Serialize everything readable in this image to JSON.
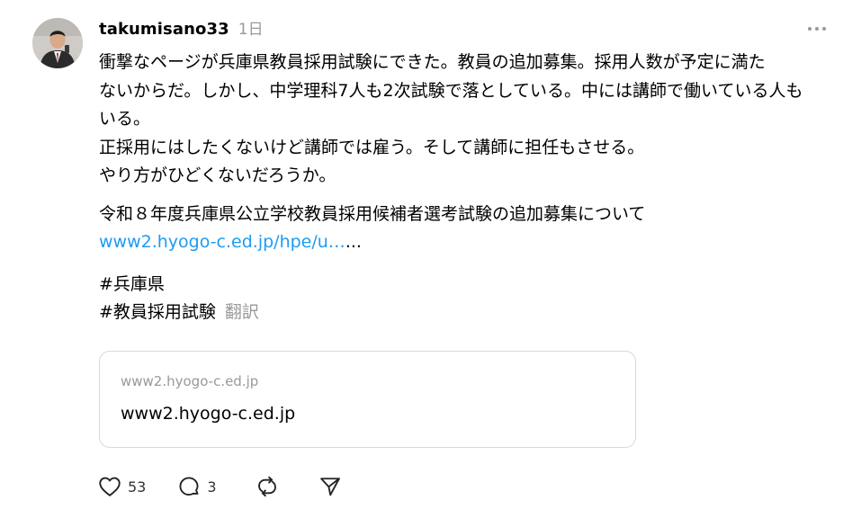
{
  "post": {
    "username": "takumisano33",
    "timestamp": "1日",
    "body_lines": [
      "衝撃なページが兵庫県教員採用試験にできた。教員の追加募集。採用人数が予定に満た",
      "ないからだ。しかし、中学理科7人も2次試験で落としている。中には講師で働いている人も",
      "いる。",
      "正採用にはしたくないけど講師では雇う。そして講師に担任もさせる。",
      "やり方がひどくないだろうか。"
    ],
    "announcement": "令和８年度兵庫県公立学校教員採用候補者選考試験の追加募集について",
    "link_text": "www2.hyogo-c.ed.jp/hpe/u…",
    "link_suffix": "...",
    "hashtags": [
      "#兵庫県",
      "#教員採用試験"
    ],
    "translate_label": "翻訳"
  },
  "link_card": {
    "domain": "www2.hyogo-c.ed.jp",
    "title": "www2.hyogo-c.ed.jp"
  },
  "actions": {
    "like_count": "53",
    "reply_count": "3"
  },
  "icons": {
    "more": "more-horizontal-icon",
    "like": "heart-icon",
    "reply": "comment-icon",
    "repost": "repost-icon",
    "share": "send-icon"
  },
  "colors": {
    "link": "#1d9bf0",
    "muted": "#999999",
    "border": "#d9d9d9"
  }
}
